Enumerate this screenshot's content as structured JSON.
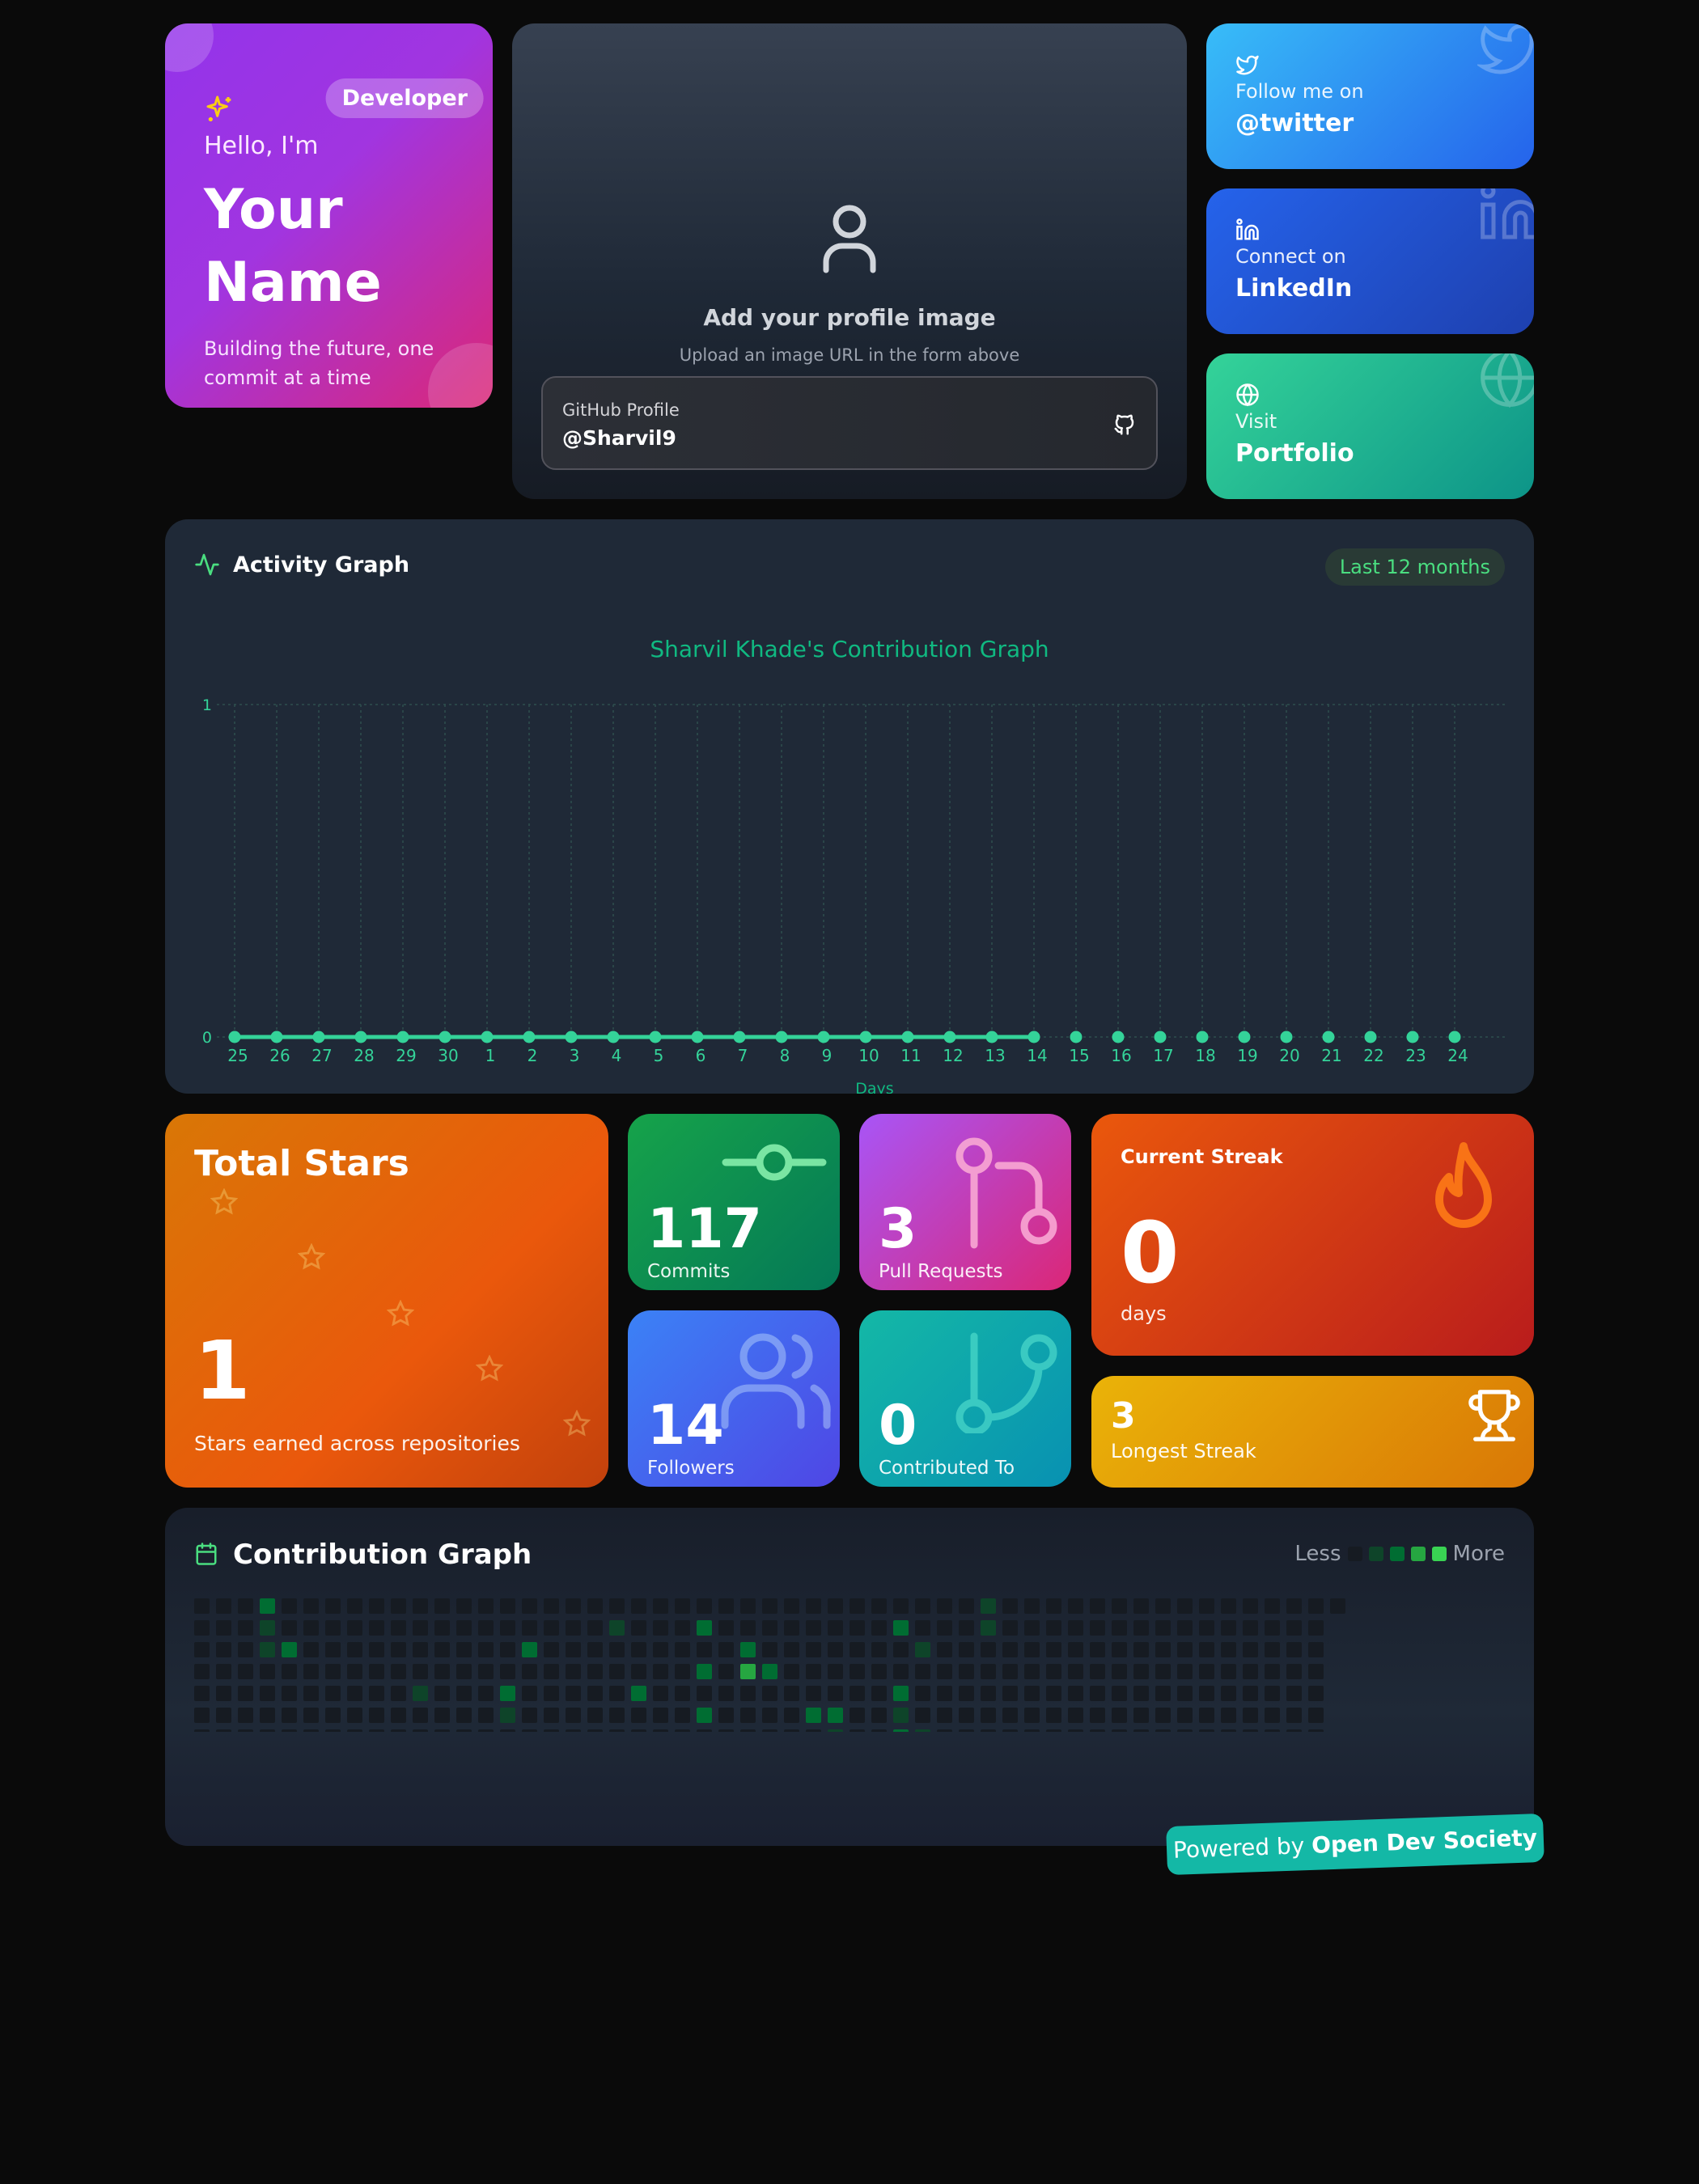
{
  "intro": {
    "badge": "Developer",
    "greeting": "Hello, I'm",
    "name": "Your Name",
    "tagline": "Building the future, one commit at a time",
    "colors": {
      "from": "#9333ea",
      "to": "#db2777"
    }
  },
  "profile": {
    "placeholder_icon": "user-icon",
    "title": "Add your profile image",
    "hint": "Upload an image URL in the form above",
    "github_label": "GitHub Profile",
    "github_handle": "@Sharvil9"
  },
  "social": {
    "twitter": {
      "icon": "twitter-icon",
      "line1": "Follow me on",
      "line2": "@twitter"
    },
    "linkedin": {
      "icon": "linkedin-icon",
      "line1": "Connect on",
      "line2": "LinkedIn"
    },
    "portfolio": {
      "icon": "globe-icon",
      "line1": "Visit",
      "line2": "Portfolio"
    }
  },
  "activity": {
    "title": "Activity Graph",
    "range_label": "Last 12 months"
  },
  "chart_data": {
    "type": "line",
    "title": "Sharvil Khade's Contribution Graph",
    "xlabel": "Days",
    "ylabel": "",
    "ylim": [
      0,
      1
    ],
    "yticks": [
      "0",
      "1"
    ],
    "categories": [
      "25",
      "26",
      "27",
      "28",
      "29",
      "30",
      "1",
      "2",
      "3",
      "4",
      "5",
      "6",
      "7",
      "8",
      "9",
      "10",
      "11",
      "12",
      "13",
      "14",
      "15",
      "16",
      "17",
      "18",
      "19",
      "20",
      "21",
      "22",
      "23",
      "24"
    ],
    "series": [
      {
        "values": [
          0,
          0,
          0,
          0,
          0,
          0,
          0,
          0,
          0,
          0,
          0,
          0,
          0,
          0,
          0,
          0,
          0,
          0,
          0,
          0,
          0,
          0,
          0,
          0,
          0,
          0,
          0,
          0,
          0,
          0
        ]
      }
    ],
    "grid": true,
    "color": "#34d399"
  },
  "stats": {
    "total_stars": {
      "title": "Total Stars",
      "value": "1",
      "subtitle": "Stars earned across repositories"
    },
    "commits": {
      "value": "117",
      "label": "Commits"
    },
    "pull_requests": {
      "value": "3",
      "label": "Pull Requests"
    },
    "followers": {
      "value": "14",
      "label": "Followers"
    },
    "contributed_to": {
      "value": "0",
      "label": "Contributed To"
    },
    "current_streak": {
      "label": "Current Streak",
      "value": "0",
      "unit": "days"
    },
    "longest_streak": {
      "value": "3",
      "label": "Longest Streak"
    }
  },
  "contribution": {
    "title": "Contribution Graph",
    "legend_less": "Less",
    "legend_more": "More",
    "palette": [
      "#161b22",
      "#0e4429",
      "#006d32",
      "#26a641",
      "#39d353"
    ],
    "weeks": 53,
    "cells": [
      {
        "w": 3,
        "d": 0,
        "l": 2
      },
      {
        "w": 3,
        "d": 1,
        "l": 1
      },
      {
        "w": 3,
        "d": 2,
        "l": 1
      },
      {
        "w": 4,
        "d": 2,
        "l": 2
      },
      {
        "w": 10,
        "d": 4,
        "l": 1
      },
      {
        "w": 14,
        "d": 4,
        "l": 2
      },
      {
        "w": 14,
        "d": 5,
        "l": 1
      },
      {
        "w": 15,
        "d": 2,
        "l": 2
      },
      {
        "w": 19,
        "d": 1,
        "l": 1
      },
      {
        "w": 20,
        "d": 4,
        "l": 2
      },
      {
        "w": 23,
        "d": 1,
        "l": 2
      },
      {
        "w": 23,
        "d": 3,
        "l": 2
      },
      {
        "w": 23,
        "d": 5,
        "l": 2
      },
      {
        "w": 25,
        "d": 2,
        "l": 2
      },
      {
        "w": 25,
        "d": 3,
        "l": 3
      },
      {
        "w": 26,
        "d": 3,
        "l": 2
      },
      {
        "w": 28,
        "d": 5,
        "l": 2
      },
      {
        "w": 29,
        "d": 5,
        "l": 2
      },
      {
        "w": 29,
        "d": 6,
        "l": 1
      },
      {
        "w": 32,
        "d": 1,
        "l": 2
      },
      {
        "w": 32,
        "d": 4,
        "l": 2
      },
      {
        "w": 32,
        "d": 5,
        "l": 1
      },
      {
        "w": 32,
        "d": 6,
        "l": 2
      },
      {
        "w": 33,
        "d": 2,
        "l": 1
      },
      {
        "w": 33,
        "d": 6,
        "l": 1
      },
      {
        "w": 36,
        "d": 0,
        "l": 1
      },
      {
        "w": 36,
        "d": 1,
        "l": 1
      }
    ]
  },
  "footer": {
    "powered_prefix": "Powered by ",
    "powered_name": "Open Dev Society"
  }
}
